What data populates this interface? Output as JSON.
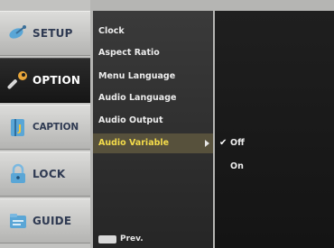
{
  "sidebar": {
    "tabs": [
      {
        "label": "SETUP",
        "icon": "satellite-dish-icon",
        "active": false
      },
      {
        "label": "OPTION",
        "icon": "wrench-icon",
        "active": true
      },
      {
        "label": "CAPTION",
        "icon": "caption-book-icon",
        "active": false
      },
      {
        "label": "LOCK",
        "icon": "padlock-icon",
        "active": false
      },
      {
        "label": "GUIDE",
        "icon": "guide-folder-icon",
        "active": false
      }
    ]
  },
  "menu": {
    "items": [
      {
        "label": "Clock"
      },
      {
        "label": "Aspect Ratio"
      },
      {
        "label": "Menu Language"
      },
      {
        "label": "Audio Language"
      },
      {
        "label": "Audio Output"
      },
      {
        "label": "Audio Variable",
        "selected": true
      }
    ],
    "footer": {
      "key_label": "",
      "prev_label": "Prev."
    }
  },
  "options": {
    "items": [
      {
        "label": "Off",
        "checked": true
      },
      {
        "label": "On",
        "checked": false
      }
    ]
  },
  "colors": {
    "selected_text": "#f4dc4a",
    "selected_bg": "#57513c",
    "tab_text": "#2f3a52"
  }
}
